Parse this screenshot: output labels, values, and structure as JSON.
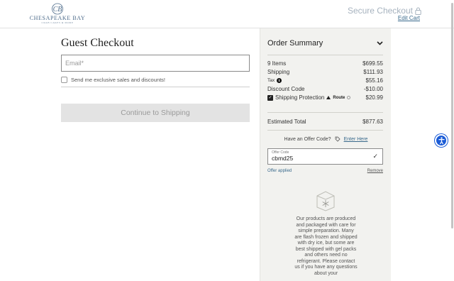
{
  "header": {
    "logo_name": "CHESAPEAKE BAY",
    "logo_tagline": "CRAB CAKES & MORE",
    "secure_checkout": "Secure Checkout",
    "edit_cart": "Edit Cart"
  },
  "checkout": {
    "title": "Guest Checkout",
    "email_placeholder": "Email*",
    "optin_label": "Send me exclusive sales and discounts!",
    "optin_checked": false,
    "continue_label": "Continue to Shipping"
  },
  "summary": {
    "title": "Order Summary",
    "items_label": "9 Items",
    "items_value": "$699.55",
    "shipping_label": "Shipping",
    "shipping_value": "$111.93",
    "tax_label": "Tax",
    "tax_value": "$55.16",
    "discount_label": "Discount Code",
    "discount_value": "-$10.00",
    "protection_label": "Shipping Protection",
    "protection_brand": "Route",
    "protection_value": "$20.99",
    "protection_checked": true,
    "total_label": "Estimated Total",
    "total_value": "$877.63",
    "offer_question": "Have an Offer Code?",
    "offer_link": "Enter Here",
    "offer_field_label": "Offer Code",
    "offer_code": "cbmd25",
    "offer_applied": "Offer applied",
    "offer_remove": "Remove",
    "notice": "Our products are produced and packaged with care for simple preparation. Many are flash frozen and shipped with dry ice, but some are best shipped with gel packs and others need no refrigerant. Please contact us if you have any questions about your"
  },
  "colors": {
    "accent_link": "#3a6a8c",
    "summary_bg": "#f2f2ef",
    "accessibility_button": "#1a5bd6"
  },
  "icons": [
    "lock-icon",
    "chevron-down-icon",
    "info-icon",
    "checkbox-checked-icon",
    "route-logo-icon",
    "tag-icon",
    "checkmark-icon",
    "snowflake-box-icon",
    "accessibility-icon"
  ]
}
